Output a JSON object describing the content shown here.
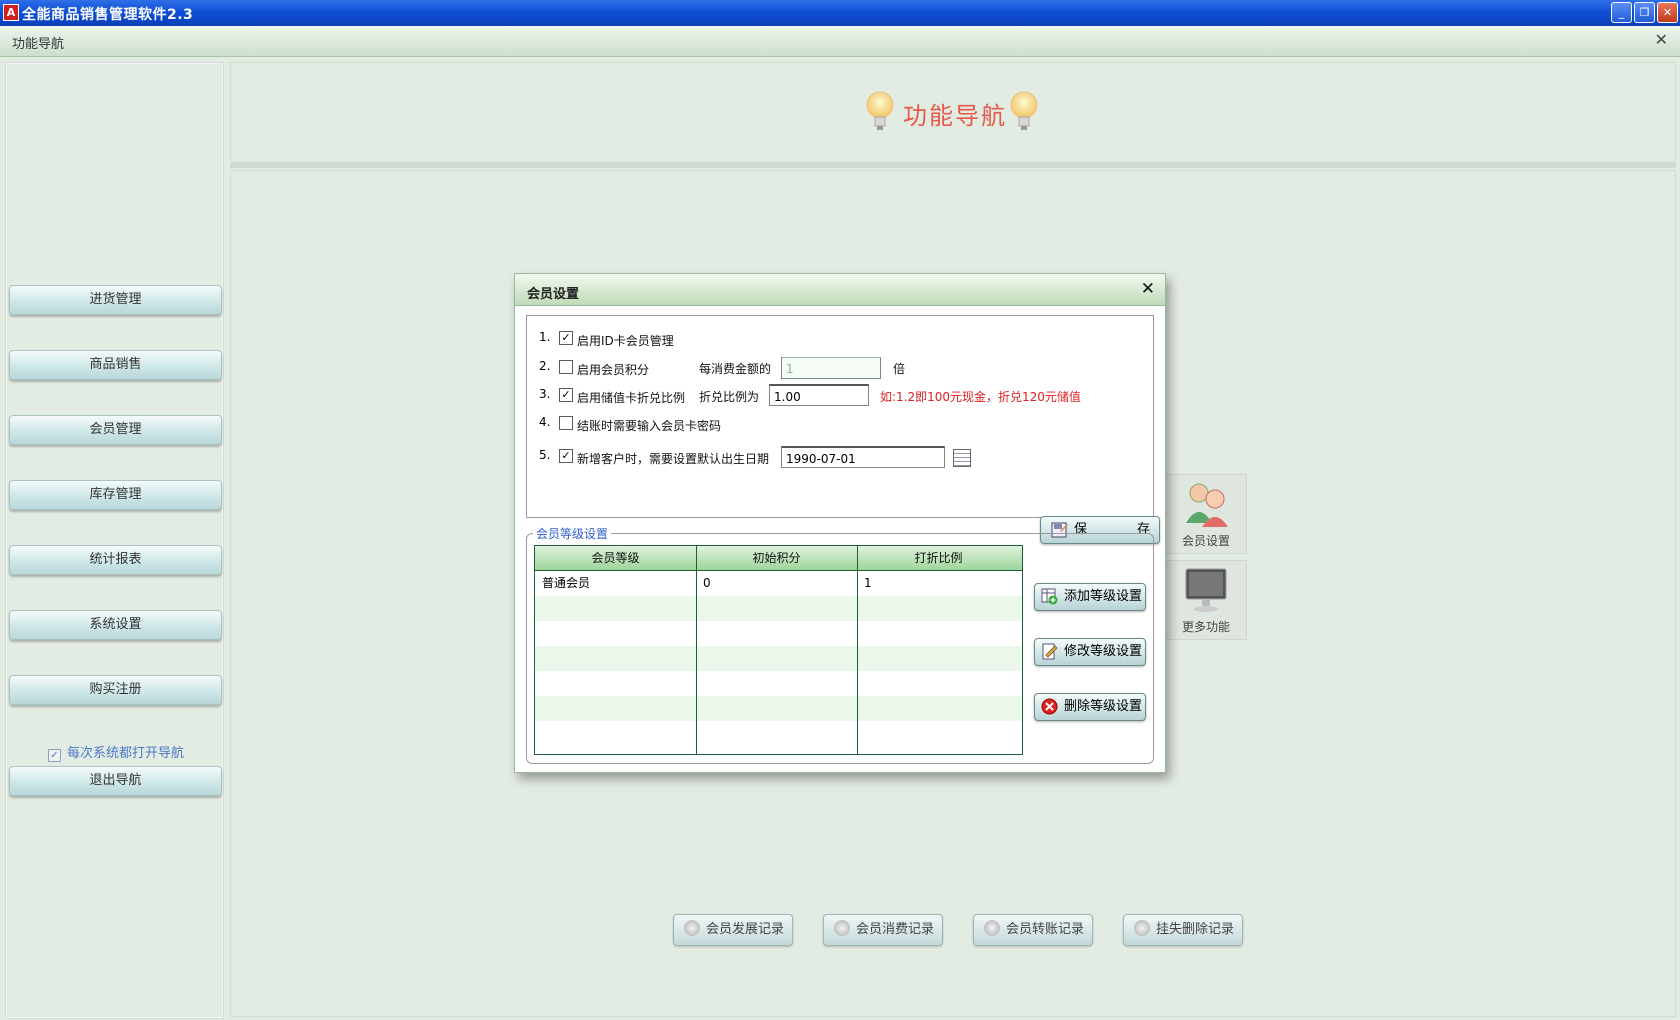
{
  "window": {
    "title": "全能商品销售管理软件2.3",
    "app_icon": "A",
    "minimize_glyph": "_",
    "restore_glyph": "❐",
    "close_glyph": "✕"
  },
  "navbar": {
    "title": "功能导航",
    "close_glyph": "✕"
  },
  "sidebar": {
    "items": [
      {
        "label": "进货管理"
      },
      {
        "label": "商品销售"
      },
      {
        "label": "会员管理"
      },
      {
        "label": "库存管理"
      },
      {
        "label": "统计报表"
      },
      {
        "label": "系统设置"
      },
      {
        "label": "购买注册"
      }
    ],
    "open_every_time_label": "每次系统都打开导航",
    "open_every_time_checked": true,
    "exit_label": "退出导航"
  },
  "header": {
    "title": "功能导航"
  },
  "func_tiles": [
    {
      "label": "会员设置",
      "icon": "members-icon"
    },
    {
      "label": "更多功能",
      "icon": "monitor-icon"
    }
  ],
  "record_buttons": [
    {
      "label": "会员发展记录"
    },
    {
      "label": "会员消费记录"
    },
    {
      "label": "会员转账记录"
    },
    {
      "label": "挂失删除记录"
    }
  ],
  "dialog": {
    "title": "会员设置",
    "close_glyph": "✕",
    "settings": [
      {
        "num": "1.",
        "label": "启用ID卡会员管理",
        "checked": true
      },
      {
        "num": "2.",
        "label": "启用会员积分",
        "checked": false,
        "sub_label": "每消费金额的",
        "value": "1",
        "suffix": "倍"
      },
      {
        "num": "3.",
        "label": "启用储值卡折兑比例",
        "checked": true,
        "sub_label": "折兑比例为",
        "value": "1.00",
        "note": "如:1.2即100元现金，折兑120元储值",
        "note_color": "#e02020"
      },
      {
        "num": "4.",
        "label": "结账时需要输入会员卡密码",
        "checked": false
      },
      {
        "num": "5.",
        "label": "新增客户时，需要设置默认出生日期",
        "checked": true,
        "value": "1990-07-01"
      }
    ],
    "check_glyph": "✓",
    "save_label_1": "保",
    "save_label_2": "存",
    "level_group": {
      "legend": "会员等级设置",
      "columns": [
        "会员等级",
        "初始积分",
        "打折比例"
      ],
      "rows": [
        [
          "普通会员",
          "0",
          "1"
        ]
      ],
      "add_label": "添加等级设置",
      "edit_label": "修改等级设置",
      "delete_label": "删除等级设置"
    }
  },
  "colors": {
    "titlebar": "#0f4fd6",
    "background": "#e3ece3",
    "heading_red": "#e45a4a",
    "link_blue": "#2f5fd0",
    "grid_border": "#1d5f3a"
  }
}
